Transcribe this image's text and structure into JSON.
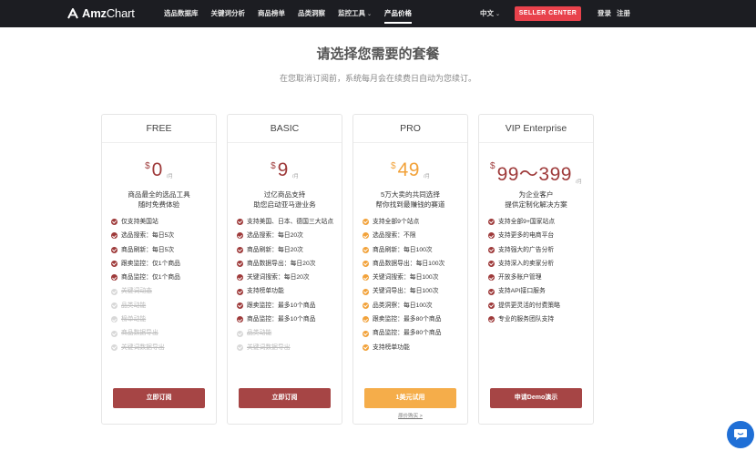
{
  "brand": {
    "name_bold": "Amz",
    "name_light": "Chart"
  },
  "nav": {
    "items": [
      {
        "label": "选品数据库",
        "active": false,
        "dropdown": false
      },
      {
        "label": "关键词分析",
        "active": false,
        "dropdown": false
      },
      {
        "label": "商品榜单",
        "active": false,
        "dropdown": false
      },
      {
        "label": "品类洞察",
        "active": false,
        "dropdown": false
      },
      {
        "label": "监控工具",
        "active": false,
        "dropdown": true
      },
      {
        "label": "产品价格",
        "active": true,
        "dropdown": false
      }
    ],
    "language": "中文",
    "seller_center": "SELLER CENTER",
    "login": "登录",
    "register": "注册"
  },
  "page": {
    "title": "请选择您需要的套餐",
    "subtitle": "在您取消订阅前，系统每月会在续费日自动为您续订。"
  },
  "plans": [
    {
      "name": "FREE",
      "currency": "$",
      "price": "0",
      "period": "/月",
      "desc_line1": "商品最全的选品工具",
      "desc_line2": "随时免费体验",
      "theme": "red",
      "features": [
        {
          "text": "仅支持美国站",
          "enabled": true
        },
        {
          "text": "选品搜索：每日5次",
          "enabled": true
        },
        {
          "text": "商品刷新：每日5次",
          "enabled": true
        },
        {
          "text": "跟卖监控：仅1个商品",
          "enabled": true
        },
        {
          "text": "商品监控：仅1个商品",
          "enabled": true
        },
        {
          "text": "关键词动态",
          "enabled": false
        },
        {
          "text": "品类动能",
          "enabled": false
        },
        {
          "text": "榜单动能",
          "enabled": false
        },
        {
          "text": "商品数据导出",
          "enabled": false
        },
        {
          "text": "关键词数据导出",
          "enabled": false
        }
      ],
      "cta": "立即订阅",
      "link": ""
    },
    {
      "name": "BASIC",
      "currency": "$",
      "price": "9",
      "period": "/月",
      "desc_line1": "过亿商品支持",
      "desc_line2": "助您启动亚马逊业务",
      "theme": "red",
      "features": [
        {
          "text": "支持美国、日本、德国三大站点",
          "enabled": true
        },
        {
          "text": "选品搜索：每日20次",
          "enabled": true
        },
        {
          "text": "商品刷新：每日20次",
          "enabled": true
        },
        {
          "text": "商品数据导出：每日20次",
          "enabled": true
        },
        {
          "text": "关键词搜索：每日20次",
          "enabled": true
        },
        {
          "text": "支持榜单功能",
          "enabled": true
        },
        {
          "text": "跟卖监控：最多10个商品",
          "enabled": true
        },
        {
          "text": "商品监控：最多10个商品",
          "enabled": true
        },
        {
          "text": "品类动能",
          "enabled": false
        },
        {
          "text": "关键词数据导出",
          "enabled": false
        }
      ],
      "cta": "立即订阅",
      "link": ""
    },
    {
      "name": "PRO",
      "currency": "$",
      "price": "49",
      "period": "/月",
      "desc_line1": "5万大卖的共同选择",
      "desc_line2": "帮你找到最赚钱的赛道",
      "theme": "orange",
      "features": [
        {
          "text": "支持全部9个站点",
          "enabled": true
        },
        {
          "text": "选品搜索：不限",
          "enabled": true
        },
        {
          "text": "商品刷新：每日100次",
          "enabled": true
        },
        {
          "text": "商品数据导出：每日100次",
          "enabled": true
        },
        {
          "text": "关键词搜索：每日100次",
          "enabled": true
        },
        {
          "text": "关键词导出：每日100次",
          "enabled": true
        },
        {
          "text": "品类洞察：每日100次",
          "enabled": true
        },
        {
          "text": "跟卖监控：最多80个商品",
          "enabled": true
        },
        {
          "text": "商品监控：最多80个商品",
          "enabled": true
        },
        {
          "text": "支持榜单功能",
          "enabled": true
        }
      ],
      "cta": "1美元试用",
      "link": "原价购买 >"
    },
    {
      "name": "VIP Enterprise",
      "currency": "$",
      "price": "99～399",
      "period": "/月",
      "desc_line1": "为企业客户",
      "desc_line2": "提供定制化解决方案",
      "theme": "red",
      "features": [
        {
          "text": "支持全部9+国家站点",
          "enabled": true
        },
        {
          "text": "支持更多的电商平台",
          "enabled": true
        },
        {
          "text": "支持强大的广告分析",
          "enabled": true
        },
        {
          "text": "支持深入的卖家分析",
          "enabled": true
        },
        {
          "text": "开放多账户管理",
          "enabled": true
        },
        {
          "text": "支持API接口服务",
          "enabled": true
        },
        {
          "text": "提供更灵活的付费策略",
          "enabled": true
        },
        {
          "text": "专业的服务团队支持",
          "enabled": true
        }
      ],
      "cta": "申请Demo演示",
      "link": ""
    }
  ],
  "colors": {
    "topbar": "#1c1d22",
    "seller_button": "#e8424c",
    "plan_red": "#9e3a3a",
    "plan_orange": "#f2a23a",
    "chat_button": "#1f6fd6"
  },
  "icons": {
    "logo": "amzchart-logo-icon",
    "feature_check": "check-circle-icon",
    "chat": "chat-bubble-icon"
  }
}
